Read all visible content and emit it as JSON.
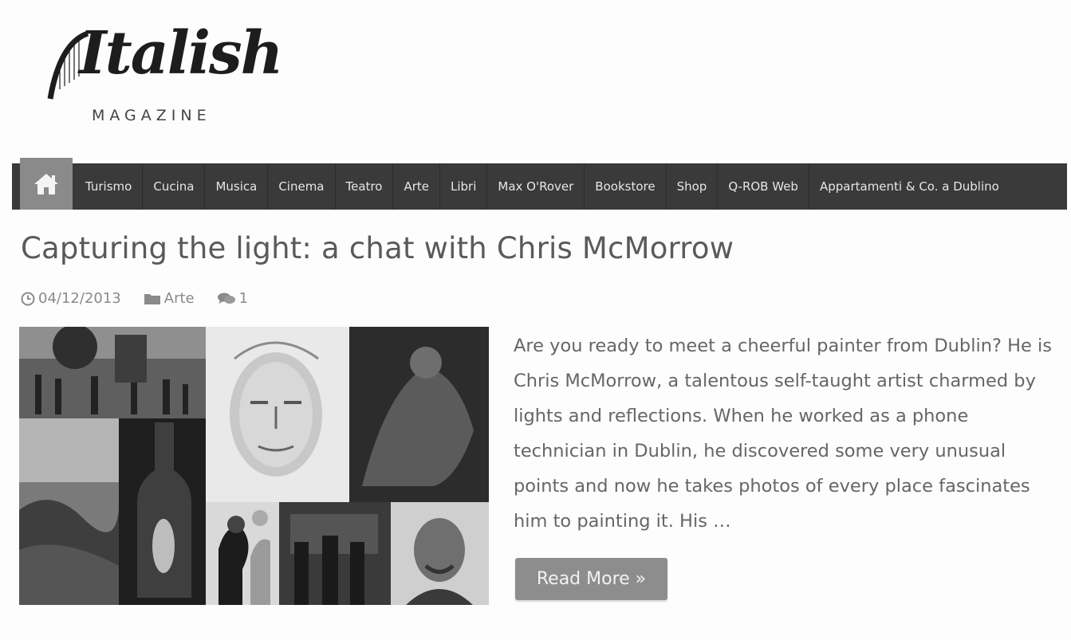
{
  "logo": {
    "script": "Italish",
    "sub": "MAGAZINE"
  },
  "nav": {
    "items": [
      "Turismo",
      "Cucina",
      "Musica",
      "Cinema",
      "Teatro",
      "Arte",
      "Libri",
      "Max O'Rover",
      "Bookstore",
      "Shop",
      "Q-ROB Web",
      "Appartamenti & Co. a Dublino"
    ]
  },
  "post": {
    "title": "Capturing the light: a chat with Chris McMorrow",
    "date": "04/12/2013",
    "category": "Arte",
    "comments": "1",
    "excerpt": "Are you ready to meet a cheerful painter from Dublin? He is Chris McMorrow, a talentous self-taught artist charmed by lights and reflections. When he worked as a phone technician in Dublin, he discovered some very unusual points and now he takes photos of every place fascinates him to painting it. His …",
    "read_more": "Read More »"
  },
  "colors": {
    "nav_bg": "#3a3a3a",
    "home_bg": "#8a8a8a",
    "button_bg": "#8d8d8d"
  }
}
